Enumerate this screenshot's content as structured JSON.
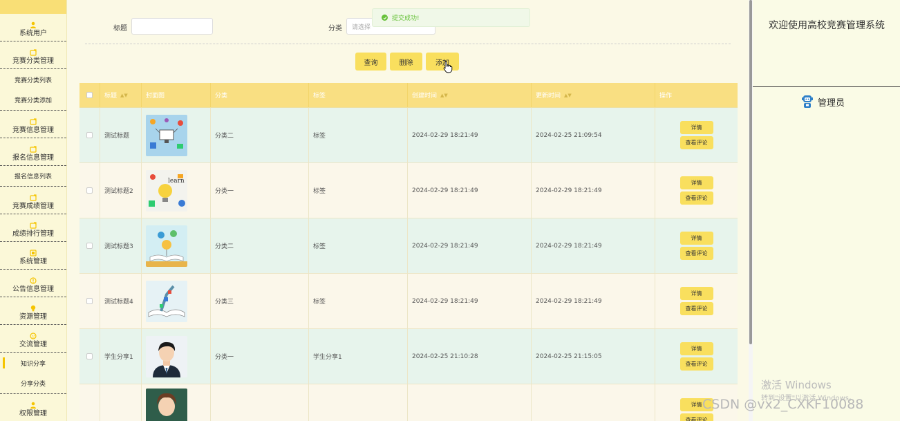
{
  "sidebar": {
    "items": [
      {
        "label": "系统用户",
        "icon": "user-icon",
        "type": "menu"
      },
      {
        "label": "竞赛分类管理",
        "icon": "folder-icon",
        "type": "menu"
      },
      {
        "label": "竞赛分类列表",
        "type": "sub"
      },
      {
        "label": "竞赛分类添加",
        "type": "sub"
      },
      {
        "label": "竞赛信息管理",
        "icon": "folder-icon",
        "type": "menu"
      },
      {
        "label": "报名信息管理",
        "icon": "folder-icon",
        "type": "menu"
      },
      {
        "label": "报名信息列表",
        "type": "sub"
      },
      {
        "label": "竞赛成绩管理",
        "icon": "folder-icon",
        "type": "menu"
      },
      {
        "label": "成绩排行管理",
        "icon": "folder-icon",
        "type": "menu"
      },
      {
        "label": "系统管理",
        "icon": "system-icon",
        "type": "menu"
      },
      {
        "label": "公告信息管理",
        "icon": "notice-icon",
        "type": "menu"
      },
      {
        "label": "资源管理",
        "icon": "bulb-icon",
        "type": "menu"
      },
      {
        "label": "交流管理",
        "icon": "chat-icon",
        "type": "menu"
      },
      {
        "label": "知识分享",
        "type": "sub",
        "active": true
      },
      {
        "label": "分享分类",
        "type": "sub"
      },
      {
        "label": "权限管理",
        "icon": "user-icon",
        "type": "menu"
      }
    ]
  },
  "search": {
    "title_label": "标题",
    "category_label": "分类",
    "category_placeholder": "请选择"
  },
  "toast": {
    "message": "提交成功!"
  },
  "toolbar": {
    "query": "查询",
    "delete": "删除",
    "add": "添加"
  },
  "table": {
    "headers": [
      "标题",
      "封面图",
      "分类",
      "标签",
      "创建时间",
      "更新时间",
      "操作"
    ],
    "rows": [
      {
        "title": "测试标题",
        "cover": "tech-illustration",
        "category": "分类二",
        "tag": "标签",
        "created": "2024-02-29 18:21:49",
        "updated": "2024-02-25 21:09:54"
      },
      {
        "title": "测试标题2",
        "cover": "learn-illustration",
        "category": "分类一",
        "tag": "标签",
        "created": "2024-02-29 18:21:49",
        "updated": "2024-02-29 18:21:49"
      },
      {
        "title": "测试标题3",
        "cover": "book-illustration",
        "category": "分类二",
        "tag": "标签",
        "created": "2024-02-29 18:21:49",
        "updated": "2024-02-29 18:21:49"
      },
      {
        "title": "测试标题4",
        "cover": "book-illustration-2",
        "category": "分类三",
        "tag": "标签",
        "created": "2024-02-29 18:21:49",
        "updated": "2024-02-29 18:21:49"
      },
      {
        "title": "学生分享1",
        "cover": "student-portrait",
        "category": "分类一",
        "tag": "学生分享1",
        "created": "2024-02-25 21:10:28",
        "updated": "2024-02-25 21:15:05"
      },
      {
        "title": "",
        "cover": "student-portrait-2",
        "category": "",
        "tag": "",
        "created": "",
        "updated": ""
      }
    ],
    "ops": {
      "detail": "详情",
      "comments": "查看评论"
    }
  },
  "right": {
    "welcome": "欢迎使用高校竞赛管理系统",
    "admin": "管理员"
  },
  "overlay": {
    "activate_title": "激活 Windows",
    "activate_sub": "转到\"设置\"以激活 Windows。",
    "csdn": "CSDN @vx2_CXKF10088"
  },
  "colors": {
    "accent": "#f9df5e",
    "header": "#f9df82",
    "success": "#67c23a"
  }
}
